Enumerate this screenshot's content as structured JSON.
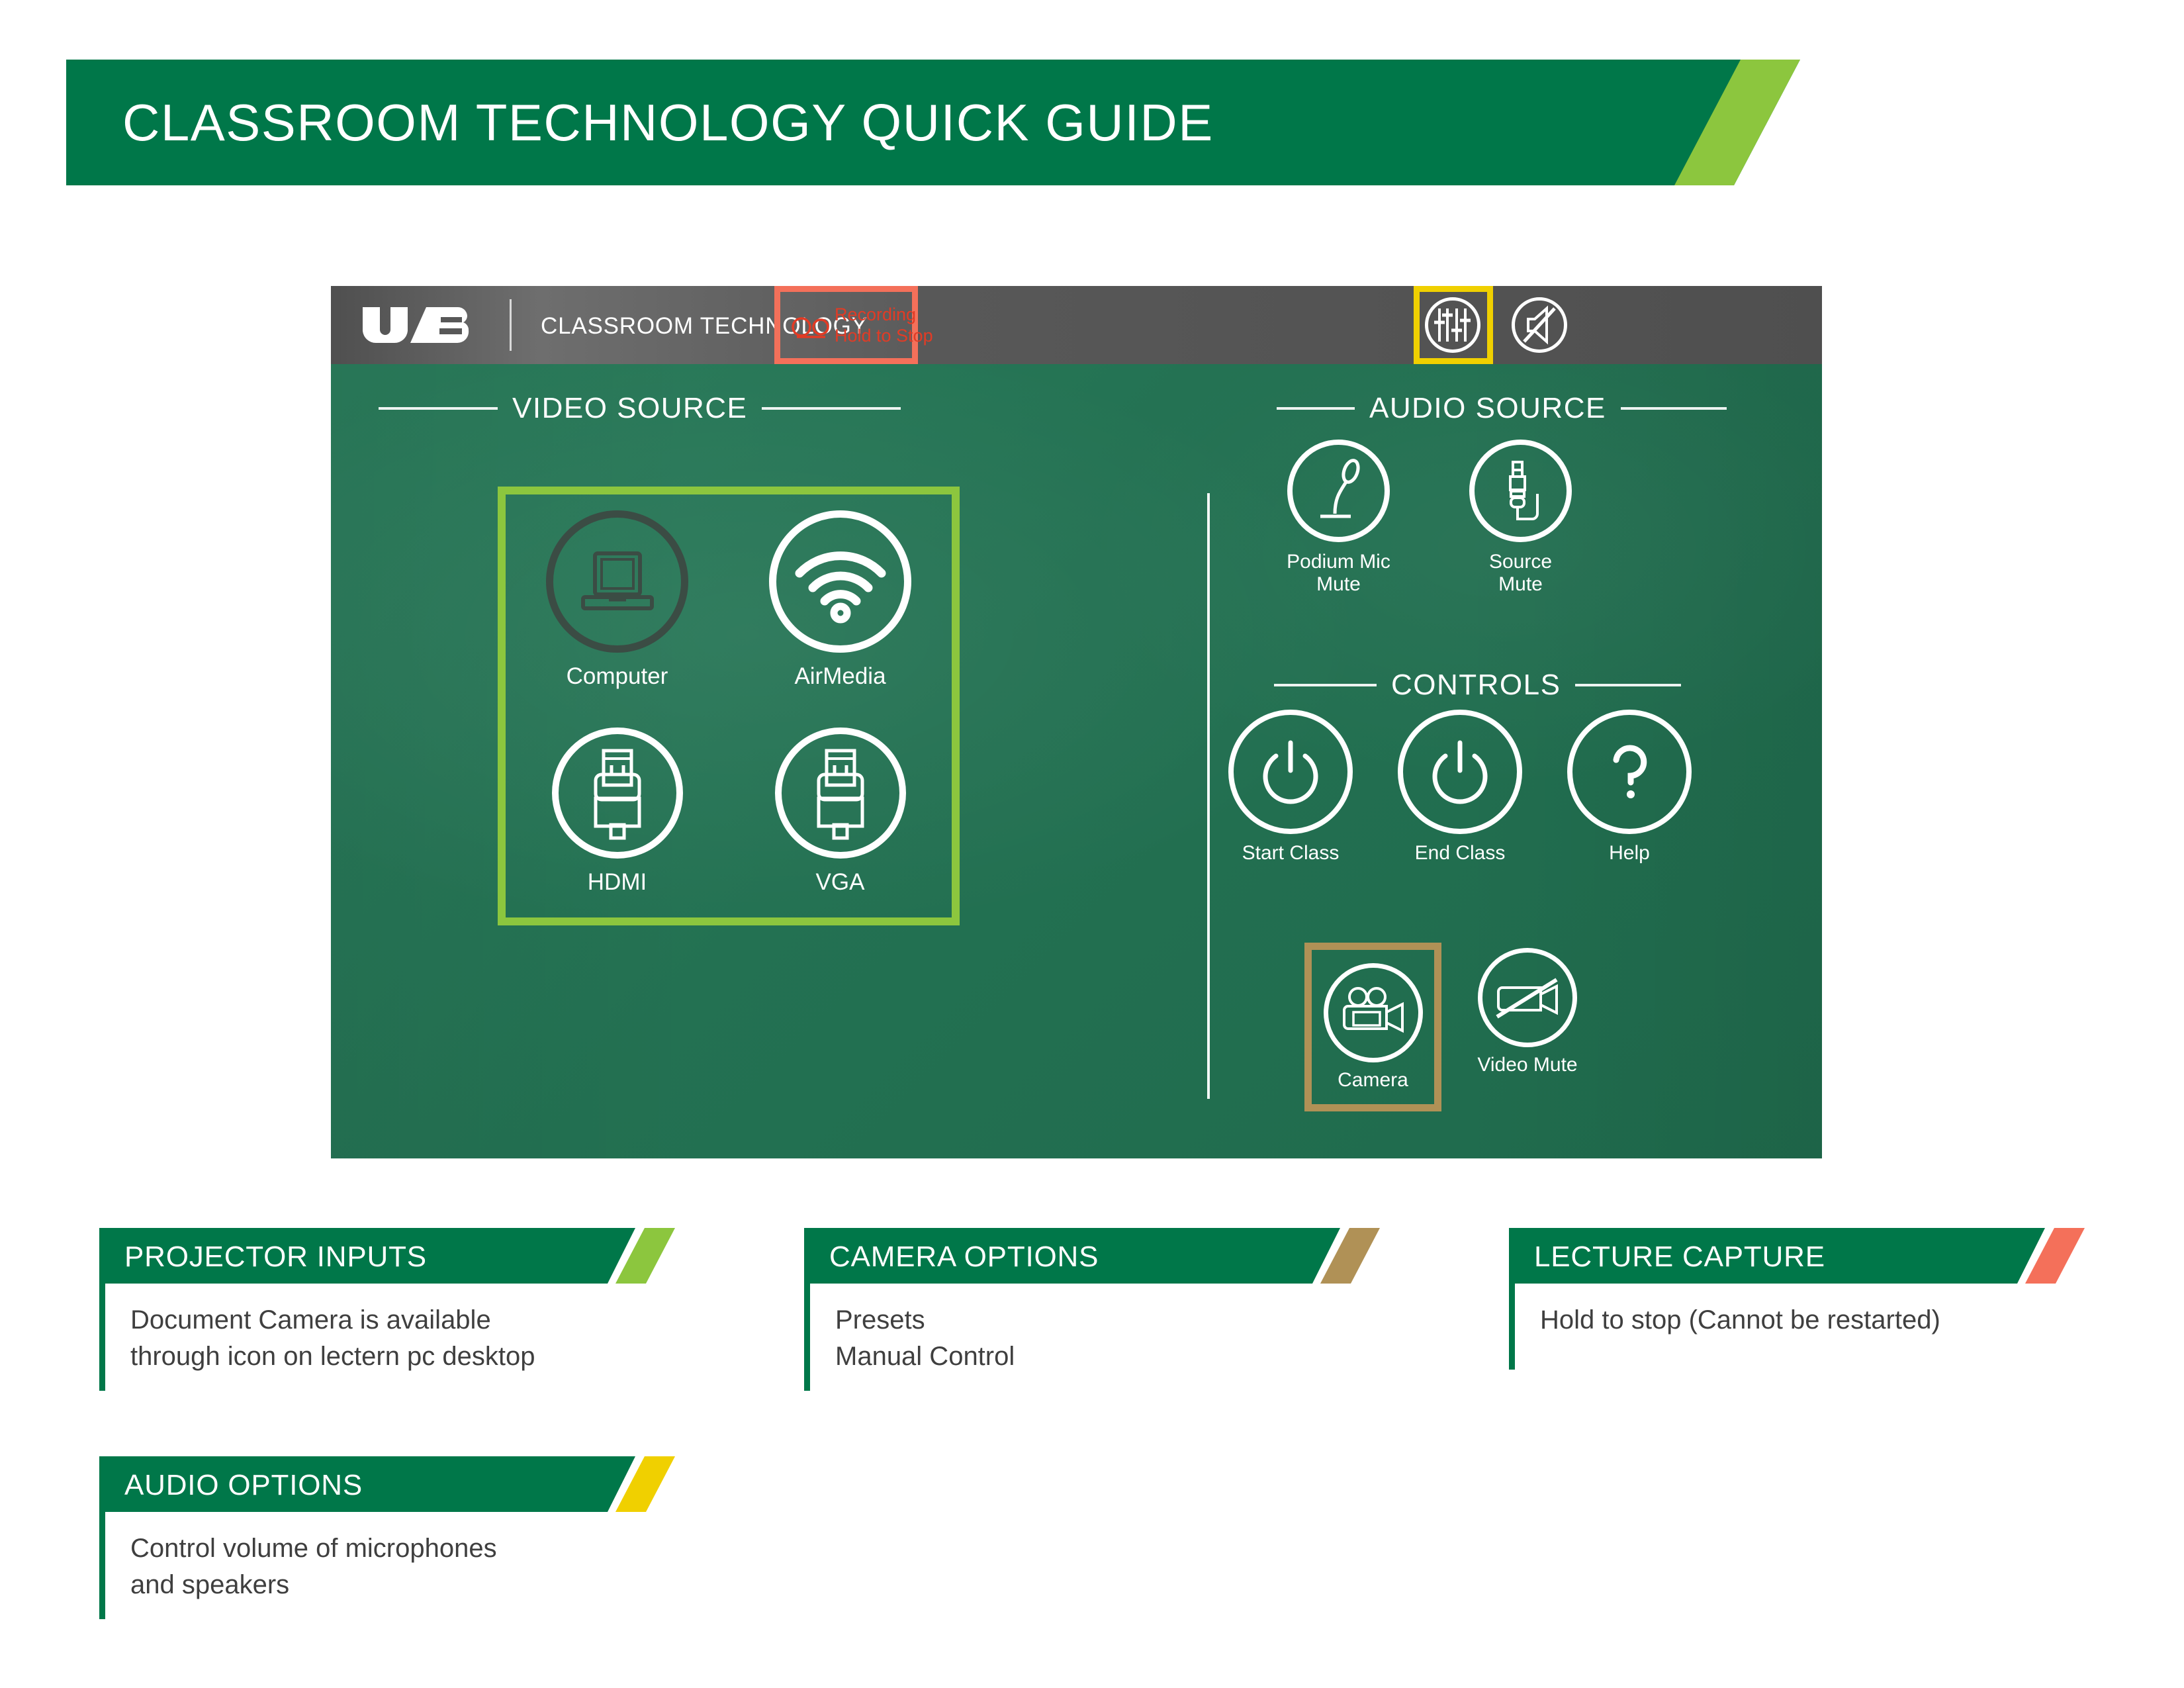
{
  "page": {
    "title": "CLASSROOM TECHNOLOGY QUICK GUIDE",
    "background_color": "#ffffff"
  },
  "colors": {
    "brand_green": "#007749",
    "panel_green": "#237152",
    "accent_green": "#8cc63e",
    "accent_gold": "#b09156",
    "accent_coral": "#f4705a",
    "accent_yellow": "#f0d000",
    "recording_red": "#e23b25",
    "header_gray": "#585858",
    "body_text": "#3f3f3f"
  },
  "panel": {
    "header": {
      "logo": "uab-logo",
      "label": "CLASSROOM TECHNOLOGY",
      "recording_button": {
        "icon": "tape-reel-icon",
        "line1": "Recording",
        "line2": "Hold to Stop",
        "highlight_color": "#f4705a"
      },
      "right_icons": [
        {
          "name": "audio-levels-icon",
          "highlight_color": "#f0d000",
          "highlighted": true
        },
        {
          "name": "volume-mute-icon",
          "highlighted": false
        }
      ]
    },
    "video_source": {
      "section_title": "VIDEO SOURCE",
      "highlight_color": "#8cc63e",
      "buttons": [
        {
          "label": "Computer",
          "icon": "laptop-icon",
          "state": "dimmed"
        },
        {
          "label": "AirMedia",
          "icon": "wifi-icon",
          "state": "normal"
        },
        {
          "label": "HDMI",
          "icon": "hdmi-cable-icon",
          "state": "normal"
        },
        {
          "label": "VGA",
          "icon": "vga-cable-icon",
          "state": "normal"
        }
      ]
    },
    "audio_source": {
      "section_title": "AUDIO SOURCE",
      "buttons": [
        {
          "label_line1": "Podium Mic",
          "label_line2": "Mute",
          "icon": "podium-mic-icon"
        },
        {
          "label_line1": "Source",
          "label_line2": "Mute",
          "icon": "audio-jack-icon"
        }
      ]
    },
    "controls": {
      "section_title": "CONTROLS",
      "buttons": [
        {
          "label": "Start Class",
          "icon": "power-icon"
        },
        {
          "label": "End Class",
          "icon": "power-icon"
        },
        {
          "label": "Help",
          "icon": "question-mark-icon"
        },
        {
          "label": "Camera",
          "icon": "movie-camera-icon",
          "highlight_color": "#b09156"
        },
        {
          "label": "Video Mute",
          "icon": "video-mute-icon"
        }
      ]
    }
  },
  "cards": [
    {
      "title": "PROJECTOR INPUTS",
      "accent_color": "#8cc63e",
      "lines": [
        "Document Camera is available",
        "through icon on lectern pc desktop"
      ]
    },
    {
      "title": "CAMERA OPTIONS",
      "accent_color": "#b09156",
      "lines": [
        "Presets",
        "Manual Control"
      ]
    },
    {
      "title": "LECTURE CAPTURE",
      "accent_color": "#f4705a",
      "lines": [
        "Hold to stop (Cannot be restarted)"
      ]
    },
    {
      "title": "AUDIO OPTIONS",
      "accent_color": "#f0d000",
      "lines": [
        "Control volume of microphones",
        "and speakers"
      ]
    }
  ]
}
